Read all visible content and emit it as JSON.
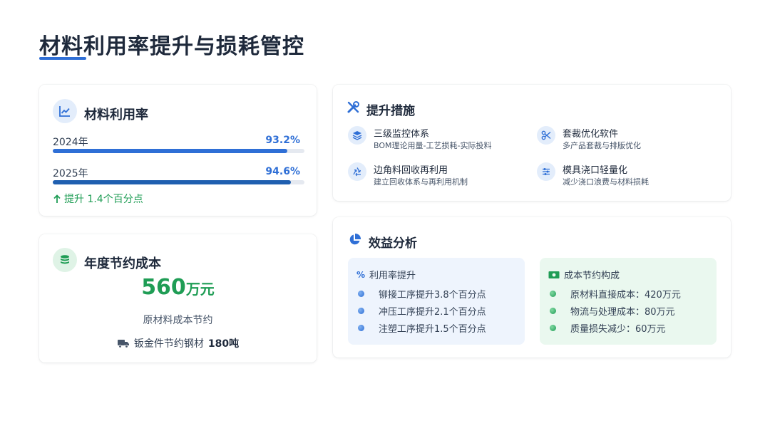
{
  "title": "材料利用率提升与损耗管控",
  "utilization": {
    "heading": "材料利用率",
    "icon": "line-chart-icon",
    "rows": [
      {
        "label": "2024年",
        "value": "93.2%",
        "percent": 93.2,
        "color": "#2f6fd6"
      },
      {
        "label": "2025年",
        "value": "94.6%",
        "percent": 94.6,
        "color": "#1f5fb0"
      }
    ],
    "improvement": "提升 1.4个百分点"
  },
  "savings": {
    "heading": "年度节约成本",
    "icon": "coins-icon",
    "amount": "560",
    "unit": "万元",
    "subtitle": "原材料成本节约",
    "steel_label": "钣金件节约钢材",
    "steel_value": "180吨"
  },
  "measures": {
    "heading": "提升措施",
    "items": [
      {
        "title": "三级监控体系",
        "desc": "BOM理论用量-工艺损耗-实际投料",
        "icon": "layers-icon"
      },
      {
        "title": "套裁优化软件",
        "desc": "多产品套裁与排版优化",
        "icon": "scissors-icon"
      },
      {
        "title": "边角料回收再利用",
        "desc": "建立回收体系与再利用机制",
        "icon": "recycle-icon"
      },
      {
        "title": "模具浇口轻量化",
        "desc": "减少浇口浪费与材料损耗",
        "icon": "sliders-icon"
      }
    ]
  },
  "benefit": {
    "heading": "效益分析",
    "utilization_panel": {
      "heading": "利用率提升",
      "items": [
        "铆接工序提升3.8个百分点",
        "冲压工序提升2.1个百分点",
        "注塑工序提升1.5个百分点"
      ]
    },
    "cost_panel": {
      "heading": "成本节约构成",
      "items": [
        "原材料直接成本：420万元",
        "物流与处理成本：80万元",
        "质量损失减少：60万元"
      ]
    }
  },
  "colors": {
    "accent_blue": "#2f6fd6",
    "accent_green": "#1f9d55"
  }
}
